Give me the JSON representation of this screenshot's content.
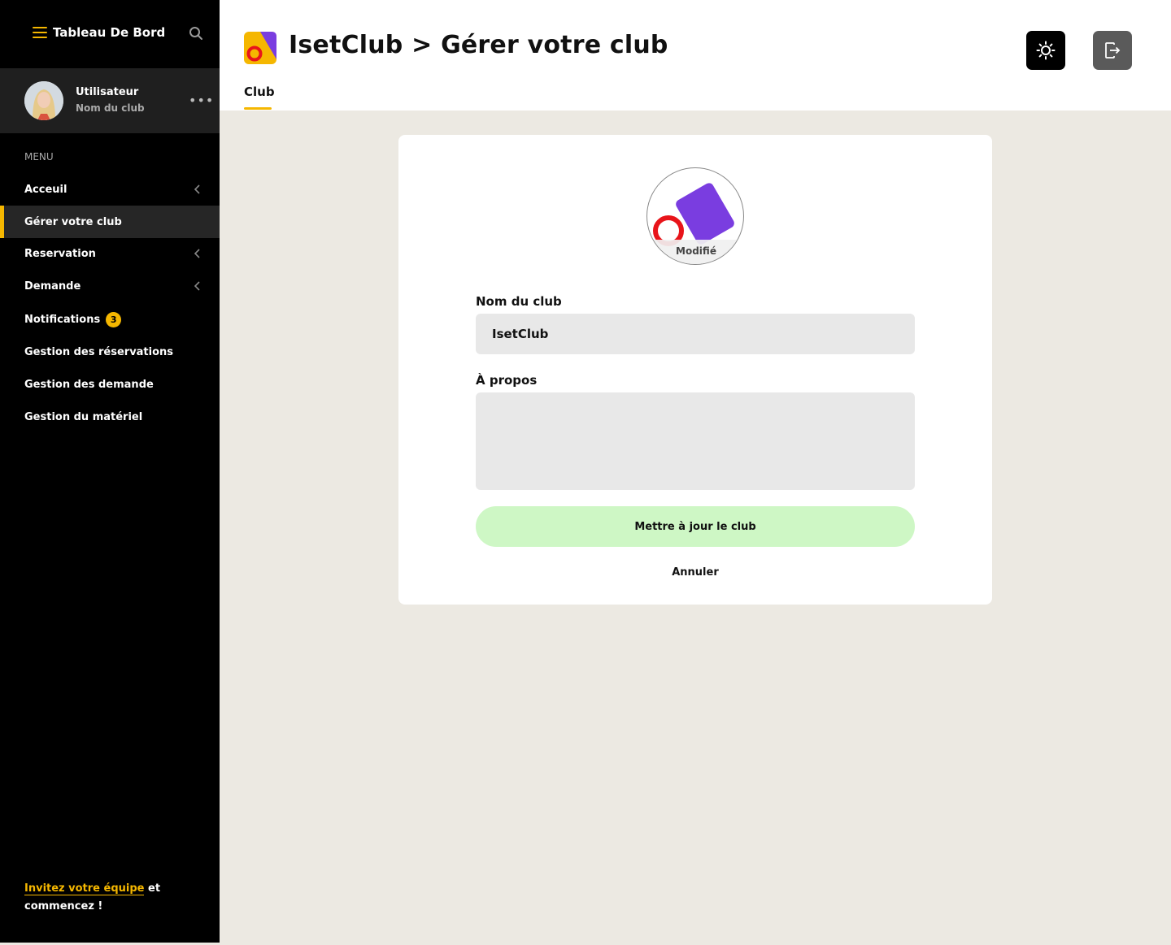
{
  "sidebar": {
    "title": "Tableau De Bord",
    "user": {
      "name": "Utilisateur",
      "club": "Nom du club"
    },
    "menu_label": "MENU",
    "items": [
      {
        "label": "Acceuil",
        "has_chevron": true
      },
      {
        "label": "Gérer votre club",
        "active": true
      },
      {
        "label": "Reservation",
        "has_chevron": true
      },
      {
        "label": "Demande",
        "has_chevron": true
      },
      {
        "label": "Notifications",
        "badge": "3"
      },
      {
        "label": "Gestion des réservations"
      },
      {
        "label": "Gestion des demande"
      },
      {
        "label": "Gestion du matériel"
      }
    ],
    "invite": {
      "link": "Invitez votre équipe",
      "rest_1": " et",
      "rest_2": "commencez !"
    }
  },
  "header": {
    "title": "IsetClub > Gérer votre club",
    "tab": "Club"
  },
  "form": {
    "avatar_caption": "Modifié",
    "name_label": "Nom du club",
    "name_value": "IsetClub",
    "about_label": "À propos",
    "about_value": "",
    "submit_label": "Mettre à jour le club",
    "cancel_label": "Annuler"
  },
  "colors": {
    "accent": "#f5b700",
    "submit_bg": "#cef7c5",
    "logo_purple": "#7a3de0",
    "logo_red": "#e8141a",
    "logo_yellow": "#f5b700"
  }
}
